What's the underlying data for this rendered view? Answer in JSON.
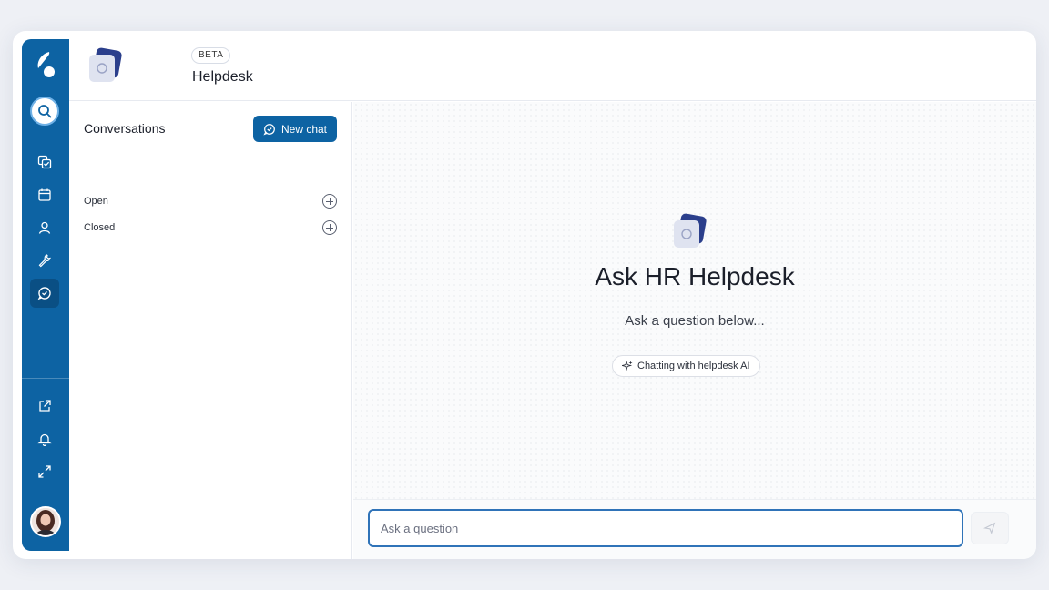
{
  "header": {
    "badge": "BETA",
    "title": "Helpdesk"
  },
  "sidebar": {
    "items": [
      {
        "icon": "search-icon"
      },
      {
        "icon": "tasks-icon"
      },
      {
        "icon": "calendar-icon"
      },
      {
        "icon": "person-icon"
      },
      {
        "icon": "wrench-icon"
      },
      {
        "icon": "helpdesk-chat-icon",
        "active": true
      },
      {
        "icon": "external-link-icon"
      },
      {
        "icon": "bell-icon"
      },
      {
        "icon": "expand-icon"
      }
    ]
  },
  "conversations": {
    "title": "Conversations",
    "new_chat_label": "New chat",
    "groups": [
      {
        "label": "Open"
      },
      {
        "label": "Closed"
      }
    ]
  },
  "main": {
    "title": "Ask HR Helpdesk",
    "subtitle": "Ask a question below...",
    "pill_label": "Chatting with helpdesk AI"
  },
  "composer": {
    "placeholder": "Ask a question"
  },
  "colors": {
    "brand": "#0d63a3",
    "brand_dark": "#0a4f84",
    "input_border": "#2f73b8"
  }
}
